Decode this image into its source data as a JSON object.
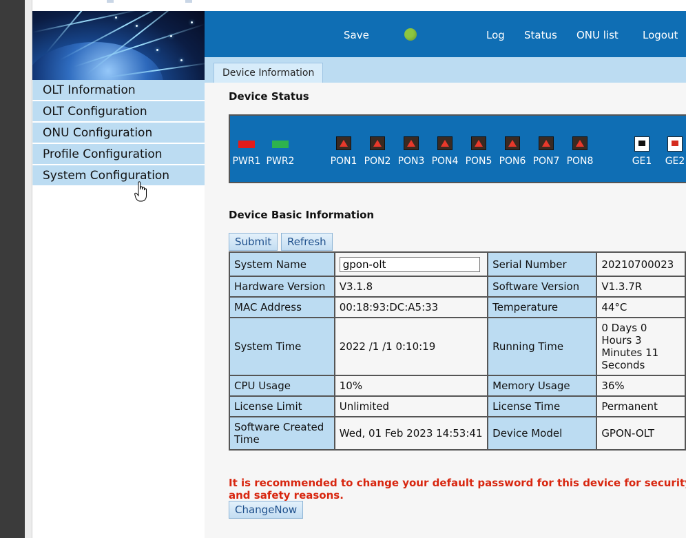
{
  "header": {
    "save_label": "Save",
    "status_led_color": "#8dc63f",
    "nav": [
      "Log",
      "Status",
      "ONU list",
      "Logout"
    ]
  },
  "tabs": [
    "Device Information"
  ],
  "sidebar": {
    "items": [
      {
        "label": "OLT Information"
      },
      {
        "label": "OLT Configuration"
      },
      {
        "label": "ONU Configuration"
      },
      {
        "label": "Profile Configuration"
      },
      {
        "label": "System Configuration"
      }
    ]
  },
  "device_status": {
    "title": "Device Status",
    "ports": [
      {
        "label": "PWR1",
        "type": "pwr",
        "color": "#e31b1b"
      },
      {
        "label": "PWR2",
        "type": "pwr",
        "color": "#2eb34d"
      },
      {
        "label": "PON1",
        "type": "pon"
      },
      {
        "label": "PON2",
        "type": "pon"
      },
      {
        "label": "PON3",
        "type": "pon"
      },
      {
        "label": "PON4",
        "type": "pon"
      },
      {
        "label": "PON5",
        "type": "pon"
      },
      {
        "label": "PON6",
        "type": "pon"
      },
      {
        "label": "PON7",
        "type": "pon"
      },
      {
        "label": "PON8",
        "type": "pon"
      },
      {
        "label": "GE1",
        "type": "ge"
      },
      {
        "label": "GE2",
        "type": "ge-red"
      }
    ]
  },
  "basic_info": {
    "title": "Device Basic Information",
    "submit_label": "Submit",
    "refresh_label": "Refresh",
    "system_name_label": "System Name",
    "system_name_value": "gpon-olt",
    "serial_number_label": "Serial Number",
    "serial_number_value": "20210700023",
    "hardware_version_label": "Hardware Version",
    "hardware_version_value": "V3.1.8",
    "software_version_label": "Software Version",
    "software_version_value": "V1.3.7R",
    "mac_label": "MAC Address",
    "mac_value": "00:18:93:DC:A5:33",
    "temperature_label": "Temperature",
    "temperature_value": "44°C",
    "system_time_label": "System Time",
    "system_time_value": "2022 /1 /1 0:10:19",
    "running_time_label": "Running Time",
    "running_time_value": "0 Days 0 Hours 3 Minutes 11 Seconds",
    "cpu_label": "CPU Usage",
    "cpu_value": "10%",
    "memory_label": "Memory Usage",
    "memory_value": "36%",
    "license_limit_label": "License Limit",
    "license_limit_value": "Unlimited",
    "license_time_label": "License Time",
    "license_time_value": "Permanent",
    "software_created_label": "Software Created Time",
    "software_created_value": "Wed, 01 Feb 2023 14:53:41",
    "device_model_label": "Device Model",
    "device_model_value": "GPON-OLT"
  },
  "warning": {
    "text": "It is recommended to change your default password for this device for security and safety reasons.",
    "button_label": "ChangeNow"
  }
}
